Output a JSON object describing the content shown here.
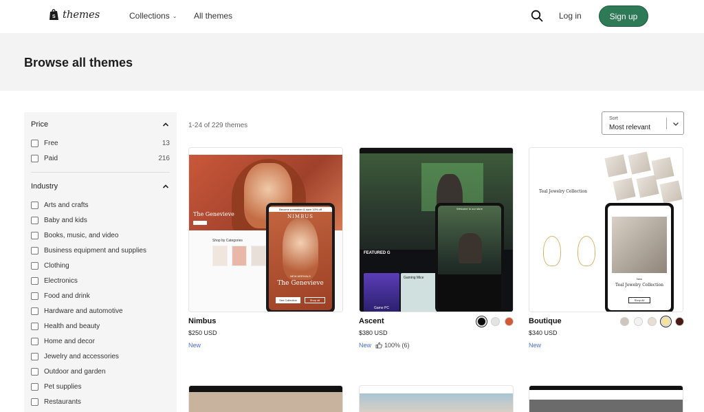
{
  "header": {
    "logo_text": "themes",
    "nav": [
      {
        "label": "Collections"
      },
      {
        "label": "All themes"
      }
    ],
    "login_label": "Log in",
    "signup_label": "Sign up"
  },
  "hero": {
    "title": "Browse all themes"
  },
  "filters": {
    "price": {
      "title": "Price",
      "options": [
        {
          "label": "Free",
          "count": "13"
        },
        {
          "label": "Paid",
          "count": "216"
        }
      ]
    },
    "industry": {
      "title": "Industry",
      "options": [
        {
          "label": "Arts and crafts"
        },
        {
          "label": "Baby and kids"
        },
        {
          "label": "Books, music, and video"
        },
        {
          "label": "Business equipment and supplies"
        },
        {
          "label": "Clothing"
        },
        {
          "label": "Electronics"
        },
        {
          "label": "Food and drink"
        },
        {
          "label": "Hardware and automotive"
        },
        {
          "label": "Health and beauty"
        },
        {
          "label": "Home and decor"
        },
        {
          "label": "Jewelry and accessories"
        },
        {
          "label": "Outdoor and garden"
        },
        {
          "label": "Pet supplies"
        },
        {
          "label": "Restaurants"
        }
      ]
    }
  },
  "results": {
    "count_text": "1-24 of 229 themes",
    "sort_label": "Sort",
    "sort_value": "Most relevant"
  },
  "themes": [
    {
      "name": "Nimbus",
      "price": "$250 USD",
      "badge": "New",
      "preview": {
        "title": "The Genevieve",
        "banner": "Become a member & save 10% off",
        "brand": "NIMBUS",
        "shop_heading": "Shop by Categories",
        "button_primary": "See Collection",
        "button_secondary": "Shop all",
        "eyebrow": "NEW ARRIVALS"
      }
    },
    {
      "name": "Ascent",
      "price": "$380 USD",
      "badge": "New",
      "rating": "100% (6)",
      "swatches": [
        "#0b0b0b",
        "#e3e3e3",
        "#cf5a36"
      ],
      "preview": {
        "banner": "Welcome to our store",
        "featured": "FEATURED G",
        "tile_1": "Game PC",
        "tile_2": "Gaming Mice"
      }
    },
    {
      "name": "Boutique",
      "price": "$340 USD",
      "badge": "New",
      "swatches": [
        "#cfc5bb",
        "#f2f2f2",
        "#e8ddd0",
        "#f5e39a",
        "#4a1a14"
      ],
      "preview": {
        "heading": "Teal Jewelry Collection",
        "label": "New",
        "button": "Shop All"
      }
    }
  ]
}
